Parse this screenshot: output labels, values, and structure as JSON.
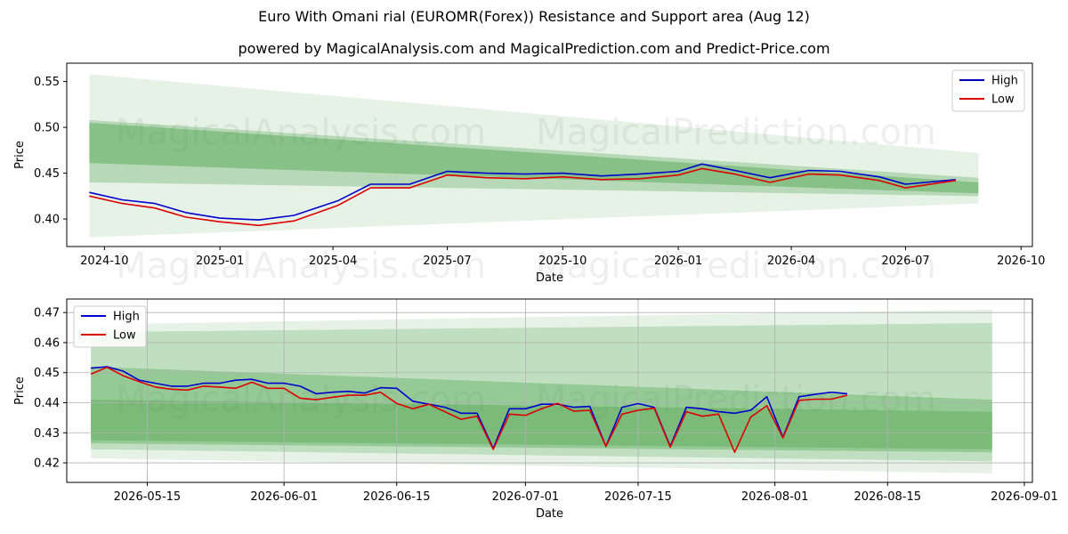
{
  "header": {
    "title": "Euro With Omani rial (EUROMR(Forex)) Resistance and Support area (Aug 12)",
    "subtitle": "powered by MagicalAnalysis.com and MagicalPrediction.com and Predict-Price.com"
  },
  "watermarks": [
    "MagicalAnalysis.com",
    "MagicalPrediction.com"
  ],
  "colors": {
    "high": "#0000cc",
    "low": "#dd0000",
    "band": "#3c9a3c",
    "grid": "#b0b0b0"
  },
  "chart_data": [
    {
      "type": "line",
      "xlabel": "Date",
      "ylabel": "Price",
      "xlim": [
        "2024-09-01",
        "2026-10-10"
      ],
      "ylim": [
        0.37,
        0.57
      ],
      "yticks": [
        0.4,
        0.45,
        0.5,
        0.55
      ],
      "ytick_labels": [
        "0.40",
        "0.45",
        "0.50",
        "0.55"
      ],
      "xticks": [
        "2024-10-01",
        "2025-01-01",
        "2025-04-01",
        "2025-07-01",
        "2025-10-01",
        "2026-01-01",
        "2026-04-01",
        "2026-07-01",
        "2026-10-01"
      ],
      "xtick_labels": [
        "2024-10",
        "2025-01",
        "2025-04",
        "2025-07",
        "2025-10",
        "2026-01",
        "2026-04",
        "2026-07",
        "2026-10"
      ],
      "grid": false,
      "legend": "top-right",
      "bands": [
        {
          "x": [
            "2024-09-19",
            "2026-08-28"
          ],
          "upper": [
            0.558,
            0.472
          ],
          "lower": [
            0.38,
            0.417
          ],
          "opacity": 0.13
        },
        {
          "x": [
            "2024-09-19",
            "2026-08-28"
          ],
          "upper": [
            0.508,
            0.445
          ],
          "lower": [
            0.44,
            0.425
          ],
          "opacity": 0.28
        },
        {
          "x": [
            "2024-09-19",
            "2026-08-28"
          ],
          "upper": [
            0.505,
            0.44
          ],
          "lower": [
            0.461,
            0.428
          ],
          "opacity": 0.38
        }
      ],
      "series": [
        {
          "name": "High",
          "x": [
            "2024-09-19",
            "2024-10-15",
            "2024-11-10",
            "2024-12-05",
            "2025-01-01",
            "2025-02-01",
            "2025-03-01",
            "2025-04-05",
            "2025-05-01",
            "2025-06-01",
            "2025-07-01",
            "2025-08-01",
            "2025-09-01",
            "2025-10-01",
            "2025-11-01",
            "2025-12-01",
            "2026-01-01",
            "2026-01-20",
            "2026-02-15",
            "2026-03-15",
            "2026-04-15",
            "2026-05-10",
            "2026-06-10",
            "2026-07-01",
            "2026-08-10"
          ],
          "values": [
            0.429,
            0.421,
            0.417,
            0.407,
            0.401,
            0.399,
            0.404,
            0.42,
            0.438,
            0.438,
            0.452,
            0.45,
            0.449,
            0.45,
            0.447,
            0.449,
            0.452,
            0.46,
            0.453,
            0.445,
            0.453,
            0.452,
            0.446,
            0.438,
            0.443
          ]
        },
        {
          "name": "Low",
          "x": [
            "2024-09-19",
            "2024-10-15",
            "2024-11-10",
            "2024-12-05",
            "2025-01-01",
            "2025-02-01",
            "2025-03-01",
            "2025-04-05",
            "2025-05-01",
            "2025-06-01",
            "2025-07-01",
            "2025-08-01",
            "2025-09-01",
            "2025-10-01",
            "2025-11-01",
            "2025-12-01",
            "2026-01-01",
            "2026-01-20",
            "2026-02-15",
            "2026-03-15",
            "2026-04-15",
            "2026-05-10",
            "2026-06-10",
            "2026-07-01",
            "2026-08-10"
          ],
          "values": [
            0.425,
            0.417,
            0.412,
            0.402,
            0.397,
            0.393,
            0.398,
            0.415,
            0.434,
            0.434,
            0.448,
            0.445,
            0.444,
            0.446,
            0.443,
            0.444,
            0.448,
            0.455,
            0.449,
            0.44,
            0.449,
            0.448,
            0.442,
            0.434,
            0.442
          ]
        }
      ]
    },
    {
      "type": "line",
      "xlabel": "Date",
      "ylabel": "Price",
      "xlim": [
        "2026-05-05",
        "2026-09-02"
      ],
      "ylim": [
        0.4135,
        0.4745
      ],
      "yticks": [
        0.42,
        0.43,
        0.44,
        0.45,
        0.46,
        0.47
      ],
      "ytick_labels": [
        "0.42",
        "0.43",
        "0.44",
        "0.45",
        "0.46",
        "0.47"
      ],
      "xticks": [
        "2026-05-15",
        "2026-06-01",
        "2026-06-15",
        "2026-07-01",
        "2026-07-15",
        "2026-08-01",
        "2026-08-15",
        "2026-09-01"
      ],
      "xtick_labels": [
        "2026-05-15",
        "2026-06-01",
        "2026-06-15",
        "2026-07-01",
        "2026-07-15",
        "2026-08-01",
        "2026-08-15",
        "2026-09-01"
      ],
      "grid": true,
      "legend": "top-left",
      "bands": [
        {
          "x": [
            "2026-05-08",
            "2026-08-28"
          ],
          "upper": [
            0.466,
            0.471
          ],
          "lower": [
            0.4215,
            0.4165
          ],
          "opacity": 0.13
        },
        {
          "x": [
            "2026-05-08",
            "2026-08-28"
          ],
          "upper": [
            0.4635,
            0.4665
          ],
          "lower": [
            0.4245,
            0.4205
          ],
          "opacity": 0.22
        },
        {
          "x": [
            "2026-05-08",
            "2026-08-28"
          ],
          "upper": [
            0.452,
            0.441
          ],
          "lower": [
            0.4265,
            0.4235
          ],
          "opacity": 0.32
        },
        {
          "x": [
            "2026-05-08",
            "2026-08-28"
          ],
          "upper": [
            0.441,
            0.437
          ],
          "lower": [
            0.4275,
            0.4245
          ],
          "opacity": 0.3
        }
      ],
      "series": [
        {
          "name": "High",
          "x": [
            "2026-05-08",
            "2026-05-10",
            "2026-05-12",
            "2026-05-14",
            "2026-05-16",
            "2026-05-18",
            "2026-05-20",
            "2026-05-22",
            "2026-05-24",
            "2026-05-26",
            "2026-05-28",
            "2026-05-30",
            "2026-06-01",
            "2026-06-03",
            "2026-06-05",
            "2026-06-07",
            "2026-06-09",
            "2026-06-11",
            "2026-06-13",
            "2026-06-15",
            "2026-06-17",
            "2026-06-19",
            "2026-06-21",
            "2026-06-23",
            "2026-06-25",
            "2026-06-27",
            "2026-06-29",
            "2026-07-01",
            "2026-07-03",
            "2026-07-05",
            "2026-07-07",
            "2026-07-09",
            "2026-07-11",
            "2026-07-13",
            "2026-07-15",
            "2026-07-17",
            "2026-07-19",
            "2026-07-21",
            "2026-07-23",
            "2026-07-25",
            "2026-07-27",
            "2026-07-29",
            "2026-07-31",
            "2026-08-02",
            "2026-08-04",
            "2026-08-06",
            "2026-08-08",
            "2026-08-10"
          ],
          "values": [
            0.4515,
            0.452,
            0.4505,
            0.4475,
            0.4465,
            0.4455,
            0.4455,
            0.4465,
            0.4465,
            0.4475,
            0.4478,
            0.4465,
            0.4465,
            0.4455,
            0.443,
            0.4435,
            0.4438,
            0.4432,
            0.445,
            0.4448,
            0.4405,
            0.4395,
            0.4385,
            0.4365,
            0.4365,
            0.4248,
            0.438,
            0.438,
            0.4395,
            0.4395,
            0.4385,
            0.4388,
            0.4255,
            0.4385,
            0.4397,
            0.4385,
            0.4255,
            0.4385,
            0.438,
            0.437,
            0.4365,
            0.4375,
            0.442,
            0.4285,
            0.442,
            0.4428,
            0.4435,
            0.443
          ]
        },
        {
          "name": "Low",
          "x": [
            "2026-05-08",
            "2026-05-10",
            "2026-05-12",
            "2026-05-14",
            "2026-05-16",
            "2026-05-18",
            "2026-05-20",
            "2026-05-22",
            "2026-05-24",
            "2026-05-26",
            "2026-05-28",
            "2026-05-30",
            "2026-06-01",
            "2026-06-03",
            "2026-06-05",
            "2026-06-07",
            "2026-06-09",
            "2026-06-11",
            "2026-06-13",
            "2026-06-15",
            "2026-06-17",
            "2026-06-19",
            "2026-06-21",
            "2026-06-23",
            "2026-06-25",
            "2026-06-27",
            "2026-06-29",
            "2026-07-01",
            "2026-07-03",
            "2026-07-05",
            "2026-07-07",
            "2026-07-09",
            "2026-07-11",
            "2026-07-13",
            "2026-07-15",
            "2026-07-17",
            "2026-07-19",
            "2026-07-21",
            "2026-07-23",
            "2026-07-25",
            "2026-07-27",
            "2026-07-29",
            "2026-07-31",
            "2026-08-02",
            "2026-08-04",
            "2026-08-06",
            "2026-08-08",
            "2026-08-10"
          ],
          "values": [
            0.4495,
            0.4518,
            0.449,
            0.447,
            0.4452,
            0.4445,
            0.4442,
            0.4455,
            0.4452,
            0.4448,
            0.4468,
            0.4448,
            0.4448,
            0.4415,
            0.441,
            0.4418,
            0.4425,
            0.4425,
            0.4435,
            0.4398,
            0.438,
            0.4395,
            0.437,
            0.4345,
            0.4355,
            0.4245,
            0.4362,
            0.4358,
            0.438,
            0.4398,
            0.4372,
            0.4375,
            0.4255,
            0.4362,
            0.4375,
            0.4382,
            0.4252,
            0.437,
            0.4355,
            0.4362,
            0.4235,
            0.4352,
            0.439,
            0.4283,
            0.4408,
            0.4412,
            0.4412,
            0.4425
          ]
        }
      ]
    }
  ]
}
